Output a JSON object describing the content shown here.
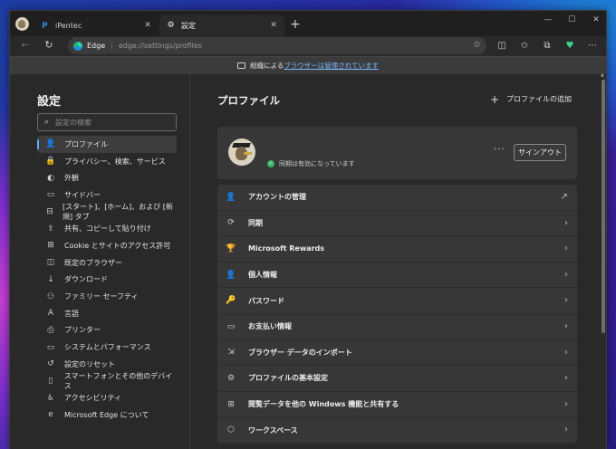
{
  "tabs": [
    {
      "title": "iPentec",
      "favicon": "P"
    },
    {
      "title": "設定",
      "favicon": "gear-icon"
    }
  ],
  "address": {
    "label": "Edge",
    "url": "edge://settings/profiles"
  },
  "managed_banner": {
    "prefix": "組織による",
    "link": "ブラウザーは管理されています"
  },
  "sidebar": {
    "title": "設定",
    "search_placeholder": "設定の検索",
    "items": [
      {
        "label": "プロファイル",
        "icon": "👤"
      },
      {
        "label": "プライバシー、検索、サービス",
        "icon": "🔒"
      },
      {
        "label": "外観",
        "icon": "◐"
      },
      {
        "label": "サイドバー",
        "icon": "▭"
      },
      {
        "label": "[スタート]、[ホーム]、および [新規] タブ",
        "icon": "⊟"
      },
      {
        "label": "共有、コピーして貼り付け",
        "icon": "⇪"
      },
      {
        "label": "Cookie とサイトのアクセス許可",
        "icon": "⊞"
      },
      {
        "label": "既定のブラウザー",
        "icon": "◫"
      },
      {
        "label": "ダウンロード",
        "icon": "↓"
      },
      {
        "label": "ファミリー セーフティ",
        "icon": "⚇"
      },
      {
        "label": "言語",
        "icon": "A"
      },
      {
        "label": "プリンター",
        "icon": "⎙"
      },
      {
        "label": "システムとパフォーマンス",
        "icon": "▭"
      },
      {
        "label": "設定のリセット",
        "icon": "↺"
      },
      {
        "label": "スマートフォンとその他のデバイス",
        "icon": "▯"
      },
      {
        "label": "アクセシビリティ",
        "icon": "♿"
      },
      {
        "label": "Microsoft Edge について",
        "icon": "e"
      }
    ]
  },
  "main": {
    "title": "プロファイル",
    "add_profile": "プロファイルの追加",
    "sync_status": "同期は有効になっています",
    "signout": "サインアウト",
    "rows": [
      {
        "label": "アカウントの管理",
        "icon": "👤",
        "trail": "↗"
      },
      {
        "label": "同期",
        "icon": "⟳",
        "trail": "›"
      },
      {
        "label": "Microsoft Rewards",
        "icon": "🏆",
        "trail": "›"
      },
      {
        "label": "個人情報",
        "icon": "👤",
        "trail": "›"
      },
      {
        "label": "パスワード",
        "icon": "🔑",
        "trail": "›"
      },
      {
        "label": "お支払い情報",
        "icon": "▭",
        "trail": "›"
      },
      {
        "label": "ブラウザー データのインポート",
        "icon": "⇲",
        "trail": "›"
      },
      {
        "label": "プロファイルの基本設定",
        "icon": "⚙",
        "trail": "›"
      },
      {
        "label": "閲覧データを他の Windows 機能と共有する",
        "icon": "⊞",
        "trail": "›"
      },
      {
        "label": "ワークスペース",
        "icon": "⬡",
        "trail": "›"
      }
    ]
  }
}
